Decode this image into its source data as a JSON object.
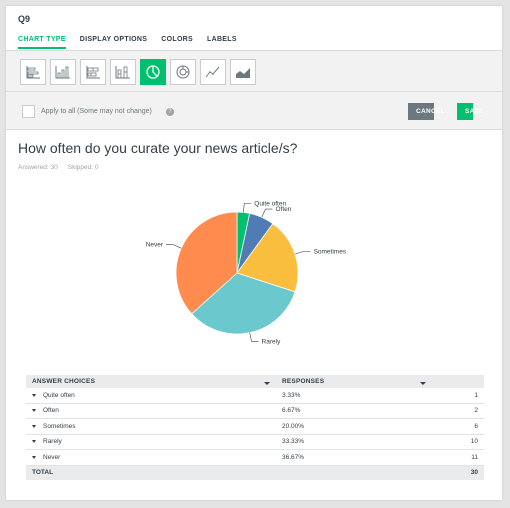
{
  "question_id": "Q9",
  "tabs": [
    {
      "label": "CHART TYPE",
      "active": true
    },
    {
      "label": "DISPLAY OPTIONS",
      "active": false
    },
    {
      "label": "COLORS",
      "active": false
    },
    {
      "label": "LABELS",
      "active": false
    }
  ],
  "chart_types": [
    "horizontal-bar-icon",
    "vertical-bar-icon",
    "stacked-horizontal-bar-icon",
    "stacked-vertical-bar-icon",
    "pie-chart-icon",
    "donut-chart-icon",
    "line-chart-icon",
    "area-chart-icon"
  ],
  "selected_chart_type": "pie-chart-icon",
  "apply_all_label": "Apply to all (Some may not change)",
  "buttons": {
    "cancel": "CANCEL",
    "save": "SAVE"
  },
  "question_title": "How often do you curate your news article/s?",
  "answered_text": "Answered: 30",
  "skipped_text": "Skipped: 0",
  "colors": {
    "accent": "#00bf6f",
    "quite_often": "#00bf6f",
    "often": "#507cb6",
    "sometimes": "#f9be3e",
    "rarely": "#6bc8cd",
    "never": "#ff8b4f"
  },
  "chart_data": {
    "type": "pie",
    "slices": [
      {
        "label": "Quite often",
        "value": 3.33,
        "color": "#00bf6f"
      },
      {
        "label": "Often",
        "value": 6.67,
        "color": "#507cb6"
      },
      {
        "label": "Sometimes",
        "value": 20.0,
        "color": "#f9be3e"
      },
      {
        "label": "Rarely",
        "value": 33.33,
        "color": "#6bc8cd"
      },
      {
        "label": "Never",
        "value": 36.67,
        "color": "#ff8b4f"
      }
    ]
  },
  "table": {
    "headers": [
      "ANSWER CHOICES",
      "RESPONSES"
    ],
    "rows": [
      {
        "choice": "Quite often",
        "percent": "3.33%",
        "count": "1"
      },
      {
        "choice": "Often",
        "percent": "6.67%",
        "count": "2"
      },
      {
        "choice": "Sometimes",
        "percent": "20.00%",
        "count": "6"
      },
      {
        "choice": "Rarely",
        "percent": "33.33%",
        "count": "10"
      },
      {
        "choice": "Never",
        "percent": "36.67%",
        "count": "11"
      }
    ],
    "total_label": "TOTAL",
    "total_value": "30"
  }
}
